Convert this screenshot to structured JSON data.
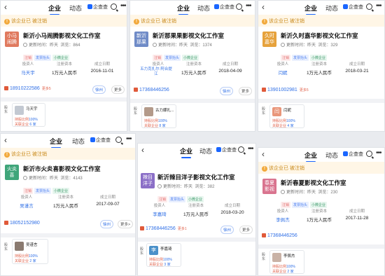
{
  "nav": {
    "back": "‹",
    "tab_company": "企业",
    "tab_dynamic": "动态",
    "qcc": "企查查",
    "more": "•••"
  },
  "warn": {
    "icon": "!",
    "text": "该企业已 被注销"
  },
  "labels": {
    "updated": "更新时间：",
    "views": "浏览：",
    "legal": "法定代表人",
    "legal_short": "投资人",
    "capital": "注册资本",
    "established": "成立日期",
    "more": "更多",
    "more_btn": "更多>",
    "loc": "徐州",
    "shadow_tag": "股东",
    "ratio_prefix": "持股比例",
    "related_prefix": "关联企业",
    "tag1": "注销",
    "tag2": "发票抬头",
    "tag3": "小微企业",
    "capital_val": "1万元人民币"
  },
  "panels": [
    {
      "name": "新沂小马闹腾影视文化工作室",
      "logo": "小马\n闹腾",
      "logo_color": "#e07a5f",
      "time": "昨天",
      "views": "864",
      "person": "马天宇",
      "date": "2016-11-01",
      "phone": "18910222586",
      "more_count": "更多5",
      "sh_name": "马天宇",
      "sh_ratio": "100%",
      "sh_rel": "6 家"
    },
    {
      "name": "新沂那果果影视文化工作室",
      "logo": "新沂\n那果",
      "logo_color": "#6f8bc7",
      "time": "昨天",
      "views": "1374",
      "person": "五力克扎尔·阿合提\n江",
      "date": "2018-04-09",
      "phone": "17368446256",
      "more_count": "更多",
      "sh_name": "古力娜扎...",
      "sh_ratio": "100%",
      "sh_rel": "8 家"
    },
    {
      "name": "新沂久时嘉华影视文化工作室",
      "logo": "久时\n嘉华",
      "logo_color": "#e6a23c",
      "time": "昨天",
      "views": "329",
      "person": "闫妮",
      "date": "2018-03-21",
      "phone": "13901002981",
      "more_count": "更多5",
      "sh_name": "闫妮",
      "sh_ratio": "100%",
      "sh_rel": "4 家"
    },
    {
      "name": "新沂市火炎喜影视文化工作室",
      "logo": "火炎\n喜",
      "logo_color": "#3fa57a",
      "time": "昨天",
      "views": "4143",
      "person": "吴谨言",
      "date": "2017-09-07",
      "phone": "18052152980",
      "more_count": "",
      "sh_name": "吴谨言",
      "sh_ratio": "100%",
      "sh_rel": "2 家"
    },
    {
      "name": "新沂辣目洋子影视文化工作室",
      "logo": "辣目\n洋子",
      "logo_color": "#8b6fc7",
      "time": "昨天",
      "views": "382",
      "person": "李嘉琦",
      "date": "2018-03-20",
      "phone": "17368446256",
      "more_count": "更多1",
      "sh_name": "李嘉琦",
      "sh_ratio": "100%",
      "sh_rel": "3 家"
    },
    {
      "name": "新沂春夏影视文化工作室",
      "logo": "春夏\n影视",
      "logo_color": "#d9748f",
      "time": "昨天",
      "views": "230",
      "person": "李佩杰",
      "date": "2017-11-28",
      "phone": "17368446256",
      "more_count": "",
      "sh_name": "李佩杰",
      "sh_ratio": "100%",
      "sh_rel": "2 家"
    }
  ]
}
